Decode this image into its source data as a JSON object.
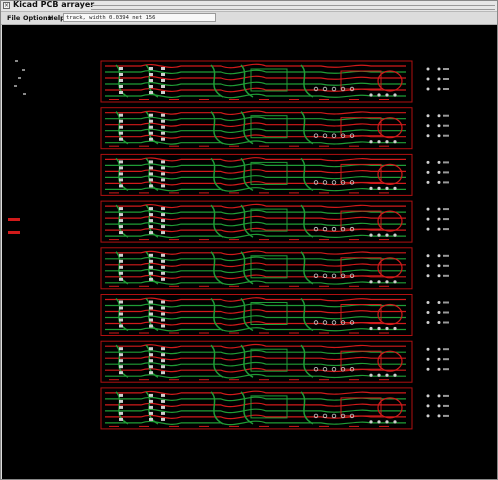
{
  "window": {
    "title": "Kicad PCB arrayer"
  },
  "menu": {
    "file": "File",
    "options": "Options",
    "help": "Help"
  },
  "status": "track, width 0.0394 net 156",
  "board": {
    "copies": 8,
    "colors": {
      "track_front": "#d11a1a",
      "track_back": "#1f9d36",
      "pad": "#cfcfcf",
      "outline": "#b01010"
    }
  }
}
